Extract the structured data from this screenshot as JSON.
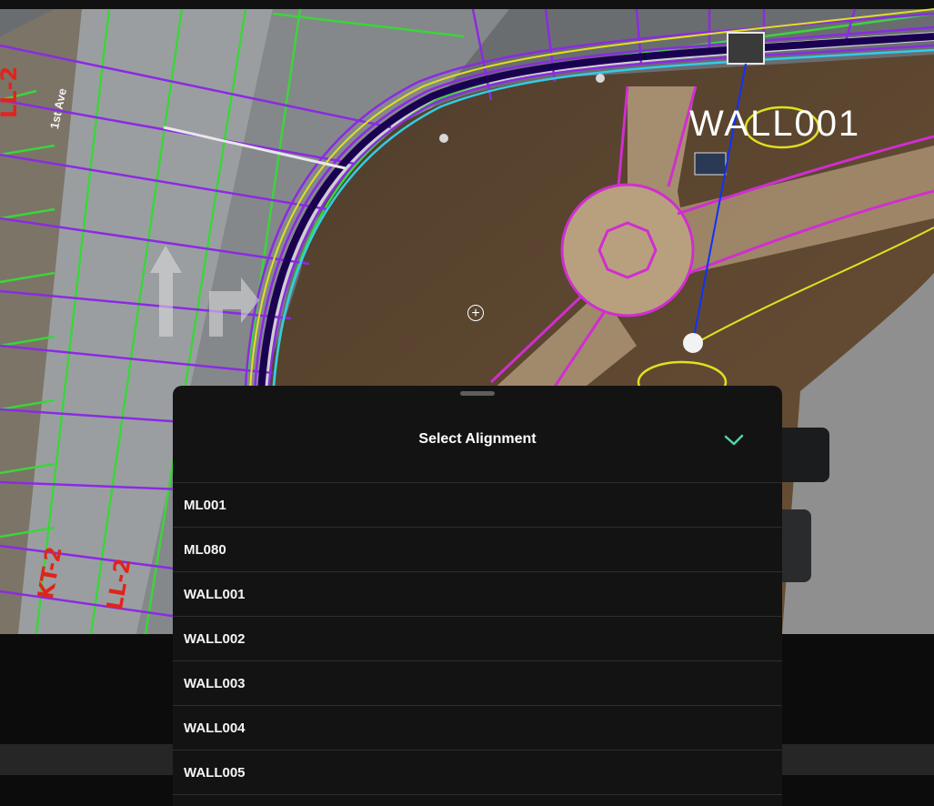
{
  "map": {
    "street_label": "1st Ave",
    "alignment_label": "WALL001",
    "red_notes": [
      "LL-2",
      "KT-2",
      "LL-2"
    ]
  },
  "sheet": {
    "title": "Select Alignment",
    "confirm_icon": "checkmark-icon",
    "items": [
      "ML001",
      "ML080",
      "WALL001",
      "WALL002",
      "WALL003",
      "WALL004",
      "WALL005"
    ]
  },
  "colors": {
    "accent": "#4fd6a8",
    "sheet_background": "#131313",
    "linework_purple": "#8a2be2",
    "linework_magenta": "#d02ed0",
    "linework_green": "#3cd43c",
    "linework_yellow": "#e0e020",
    "linework_cyan": "#33cce6"
  }
}
